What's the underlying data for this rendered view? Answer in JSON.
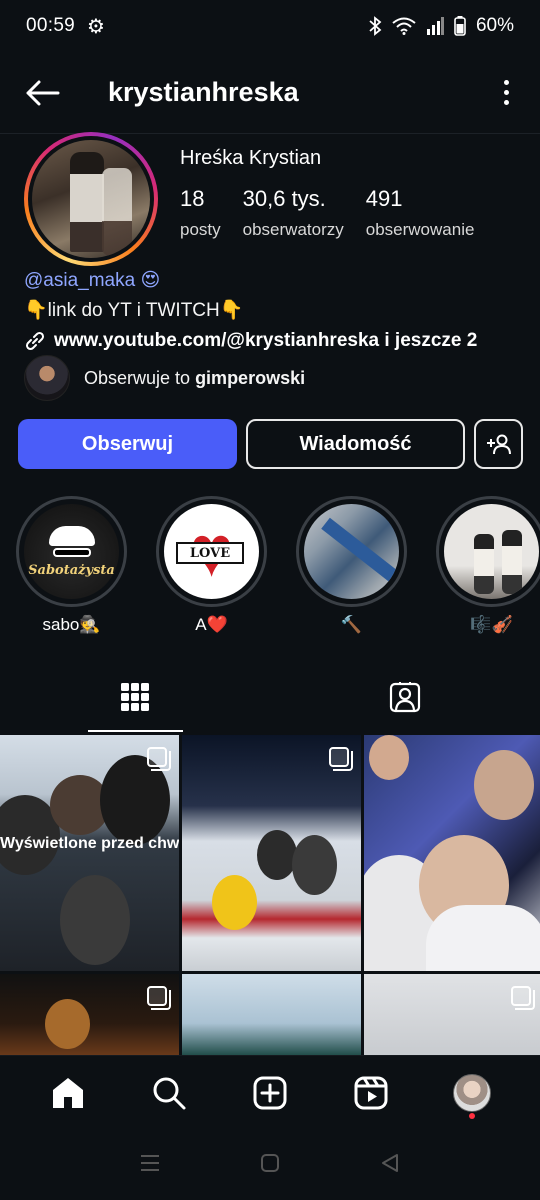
{
  "status_bar": {
    "time": "00:59",
    "battery": "60%"
  },
  "header": {
    "username": "krystianhreska"
  },
  "profile": {
    "display_name": "Hreśka Krystian",
    "stats": [
      {
        "value": "18",
        "label": "posty"
      },
      {
        "value": "30,6 tys.",
        "label": "obserwatorzy"
      },
      {
        "value": "491",
        "label": "obserwowanie"
      }
    ],
    "bio_mention": "@asia_maka 😍",
    "bio_line2": "👇link do YT i TWITCH👇",
    "bio_link": "www.youtube.com/@krystianhreska i jeszcze 2",
    "followed_by_prefix": "Obserwuje to",
    "followed_by_user": "gimperowski"
  },
  "actions": {
    "follow": "Obserwuj",
    "message": "Wiadomość"
  },
  "highlights": [
    {
      "label": "sabo🕵️",
      "art_text": "Sabotażysta"
    },
    {
      "label": "A❤️",
      "art_text": "LOVE"
    },
    {
      "label": "🔨"
    },
    {
      "label": "🎼🎻"
    }
  ],
  "grid": {
    "seen_overlay": "Wyświetlone przed chwilą"
  },
  "colors": {
    "background": "#0c1014",
    "accent": "#4a5df9",
    "mention": "#8fa6ff"
  }
}
